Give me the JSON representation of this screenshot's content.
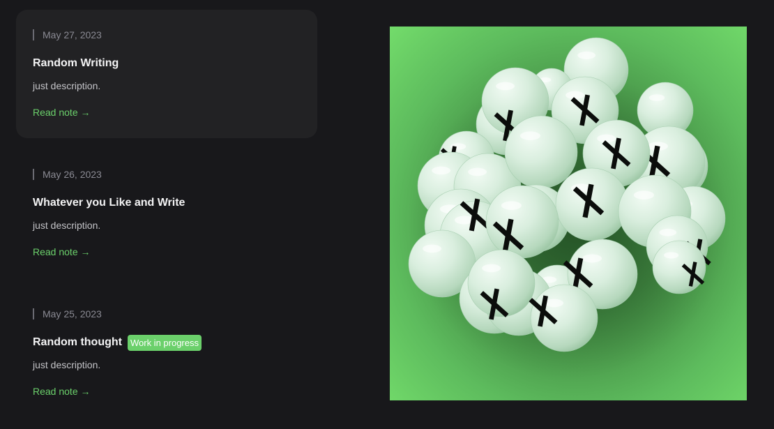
{
  "notes": [
    {
      "date": "May 27, 2023",
      "title": "Random Writing",
      "description": "just description.",
      "link_label": "Read note →"
    },
    {
      "date": "May 26, 2023",
      "title": "Whatever you Like and Write",
      "description": "just description.",
      "link_label": "Read note →"
    },
    {
      "date": "May 25, 2023",
      "title": "Random thought",
      "badge": "Work in progress",
      "description": "just description.",
      "link_label": "Read note →"
    }
  ],
  "colors": {
    "background": "#18181b",
    "card": "#222224",
    "accent": "#6bd06b",
    "art_background": "#4a9e4a",
    "sphere": "#d6ecdc"
  },
  "art": {
    "icon": "cross-spheres-illustration"
  }
}
